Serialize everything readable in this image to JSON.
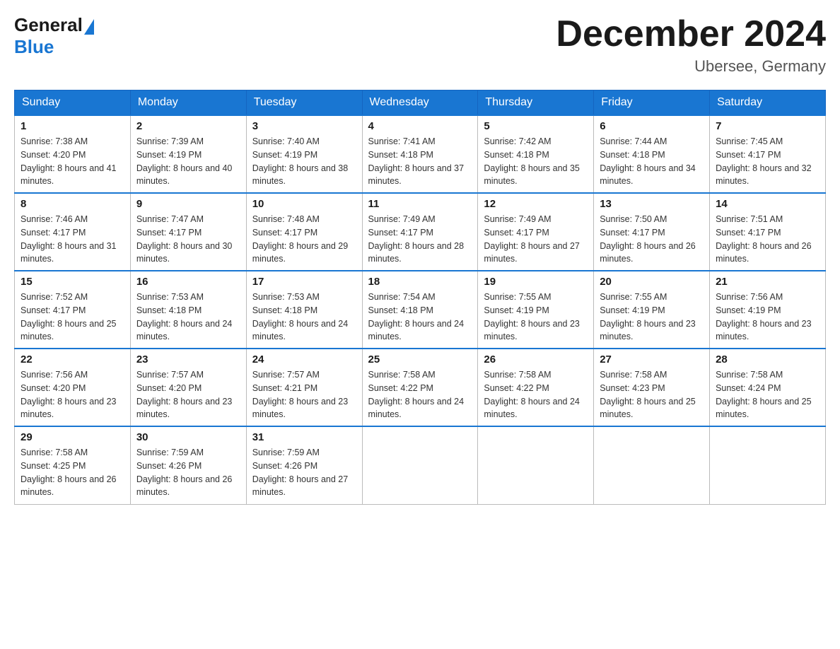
{
  "header": {
    "logo_general": "General",
    "logo_blue": "Blue",
    "month_title": "December 2024",
    "location": "Ubersee, Germany"
  },
  "weekdays": [
    "Sunday",
    "Monday",
    "Tuesday",
    "Wednesday",
    "Thursday",
    "Friday",
    "Saturday"
  ],
  "weeks": [
    [
      {
        "day": "1",
        "sunrise": "7:38 AM",
        "sunset": "4:20 PM",
        "daylight": "8 hours and 41 minutes."
      },
      {
        "day": "2",
        "sunrise": "7:39 AM",
        "sunset": "4:19 PM",
        "daylight": "8 hours and 40 minutes."
      },
      {
        "day": "3",
        "sunrise": "7:40 AM",
        "sunset": "4:19 PM",
        "daylight": "8 hours and 38 minutes."
      },
      {
        "day": "4",
        "sunrise": "7:41 AM",
        "sunset": "4:18 PM",
        "daylight": "8 hours and 37 minutes."
      },
      {
        "day": "5",
        "sunrise": "7:42 AM",
        "sunset": "4:18 PM",
        "daylight": "8 hours and 35 minutes."
      },
      {
        "day": "6",
        "sunrise": "7:44 AM",
        "sunset": "4:18 PM",
        "daylight": "8 hours and 34 minutes."
      },
      {
        "day": "7",
        "sunrise": "7:45 AM",
        "sunset": "4:17 PM",
        "daylight": "8 hours and 32 minutes."
      }
    ],
    [
      {
        "day": "8",
        "sunrise": "7:46 AM",
        "sunset": "4:17 PM",
        "daylight": "8 hours and 31 minutes."
      },
      {
        "day": "9",
        "sunrise": "7:47 AM",
        "sunset": "4:17 PM",
        "daylight": "8 hours and 30 minutes."
      },
      {
        "day": "10",
        "sunrise": "7:48 AM",
        "sunset": "4:17 PM",
        "daylight": "8 hours and 29 minutes."
      },
      {
        "day": "11",
        "sunrise": "7:49 AM",
        "sunset": "4:17 PM",
        "daylight": "8 hours and 28 minutes."
      },
      {
        "day": "12",
        "sunrise": "7:49 AM",
        "sunset": "4:17 PM",
        "daylight": "8 hours and 27 minutes."
      },
      {
        "day": "13",
        "sunrise": "7:50 AM",
        "sunset": "4:17 PM",
        "daylight": "8 hours and 26 minutes."
      },
      {
        "day": "14",
        "sunrise": "7:51 AM",
        "sunset": "4:17 PM",
        "daylight": "8 hours and 26 minutes."
      }
    ],
    [
      {
        "day": "15",
        "sunrise": "7:52 AM",
        "sunset": "4:17 PM",
        "daylight": "8 hours and 25 minutes."
      },
      {
        "day": "16",
        "sunrise": "7:53 AM",
        "sunset": "4:18 PM",
        "daylight": "8 hours and 24 minutes."
      },
      {
        "day": "17",
        "sunrise": "7:53 AM",
        "sunset": "4:18 PM",
        "daylight": "8 hours and 24 minutes."
      },
      {
        "day": "18",
        "sunrise": "7:54 AM",
        "sunset": "4:18 PM",
        "daylight": "8 hours and 24 minutes."
      },
      {
        "day": "19",
        "sunrise": "7:55 AM",
        "sunset": "4:19 PM",
        "daylight": "8 hours and 23 minutes."
      },
      {
        "day": "20",
        "sunrise": "7:55 AM",
        "sunset": "4:19 PM",
        "daylight": "8 hours and 23 minutes."
      },
      {
        "day": "21",
        "sunrise": "7:56 AM",
        "sunset": "4:19 PM",
        "daylight": "8 hours and 23 minutes."
      }
    ],
    [
      {
        "day": "22",
        "sunrise": "7:56 AM",
        "sunset": "4:20 PM",
        "daylight": "8 hours and 23 minutes."
      },
      {
        "day": "23",
        "sunrise": "7:57 AM",
        "sunset": "4:20 PM",
        "daylight": "8 hours and 23 minutes."
      },
      {
        "day": "24",
        "sunrise": "7:57 AM",
        "sunset": "4:21 PM",
        "daylight": "8 hours and 23 minutes."
      },
      {
        "day": "25",
        "sunrise": "7:58 AM",
        "sunset": "4:22 PM",
        "daylight": "8 hours and 24 minutes."
      },
      {
        "day": "26",
        "sunrise": "7:58 AM",
        "sunset": "4:22 PM",
        "daylight": "8 hours and 24 minutes."
      },
      {
        "day": "27",
        "sunrise": "7:58 AM",
        "sunset": "4:23 PM",
        "daylight": "8 hours and 25 minutes."
      },
      {
        "day": "28",
        "sunrise": "7:58 AM",
        "sunset": "4:24 PM",
        "daylight": "8 hours and 25 minutes."
      }
    ],
    [
      {
        "day": "29",
        "sunrise": "7:58 AM",
        "sunset": "4:25 PM",
        "daylight": "8 hours and 26 minutes."
      },
      {
        "day": "30",
        "sunrise": "7:59 AM",
        "sunset": "4:26 PM",
        "daylight": "8 hours and 26 minutes."
      },
      {
        "day": "31",
        "sunrise": "7:59 AM",
        "sunset": "4:26 PM",
        "daylight": "8 hours and 27 minutes."
      },
      null,
      null,
      null,
      null
    ]
  ]
}
